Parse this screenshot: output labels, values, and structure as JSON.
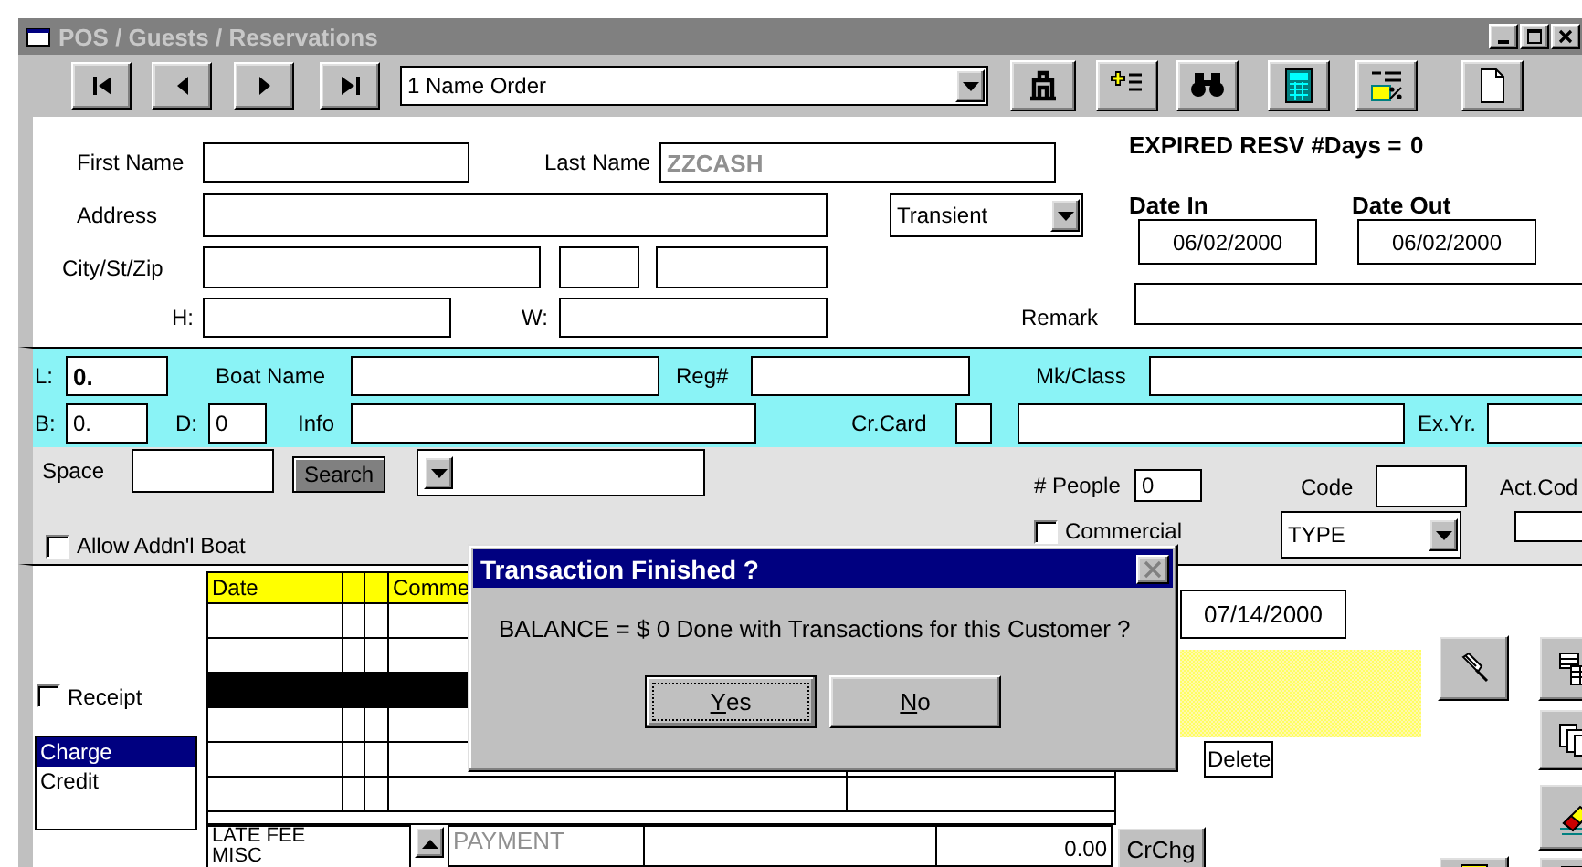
{
  "window": {
    "title": "POS / Guests / Reservations"
  },
  "toolbar": {
    "sort_order": "1 Name Order"
  },
  "guest": {
    "first_name_label": "First Name",
    "last_name_label": "Last Name",
    "last_name": "ZZCASH",
    "expired_label": "EXPIRED RESV #Days =",
    "expired_days": "0",
    "address_label": "Address",
    "guest_type": "Transient",
    "city_label": "City/St/Zip",
    "home_phone_label": "H:",
    "work_phone_label": "W:",
    "remark_label": "Remark",
    "date_in_label": "Date In",
    "date_in": "06/02/2000",
    "date_out_label": "Date Out",
    "date_out": "06/02/2000"
  },
  "boat": {
    "length_label": "L:",
    "length": "0.",
    "name_label": "Boat Name",
    "reg_label": "Reg#",
    "class_label": "Mk/Class",
    "beam_label": "B:",
    "beam": "0.",
    "draft_label": "D:",
    "draft": "0",
    "info_label": "Info",
    "card_label": "Cr.Card",
    "expiry_label": "Ex.Yr."
  },
  "space": {
    "label": "Space",
    "search_button": "Search",
    "allow_boat": {
      "label": "Allow Addn'l Boat",
      "checked": false
    },
    "people_label": "# People",
    "people": "0",
    "code_label": "Code",
    "act_code_label": "Act.Cod",
    "commercial": {
      "label": "Commercial",
      "checked": false
    },
    "type": "TYPE"
  },
  "transactions": {
    "receipt": {
      "label": "Receipt",
      "checked": false
    },
    "modes": [
      {
        "label": "Charge",
        "selected": true
      },
      {
        "label": "Credit",
        "selected": false
      }
    ],
    "date_column": "Date",
    "comment_column": "Comme",
    "rows": [
      {
        "selected": false
      },
      {
        "selected": false
      },
      {
        "selected": true
      },
      {
        "selected": false
      },
      {
        "selected": false
      },
      {
        "selected": false
      }
    ],
    "charge_types": [
      "LATE FEE",
      "MISC"
    ],
    "payment": "PAYMENT",
    "amount": "0.00",
    "crchg_button": "CrChg",
    "date": "07/14/2000",
    "delete_button": "Delete"
  },
  "dialog": {
    "title": "Transaction Finished ?",
    "message": "BALANCE = $ 0 Done with Transactions for this Customer ?",
    "buttons": [
      {
        "label": "Yes",
        "default": true
      },
      {
        "label": "No",
        "default": false
      }
    ]
  }
}
